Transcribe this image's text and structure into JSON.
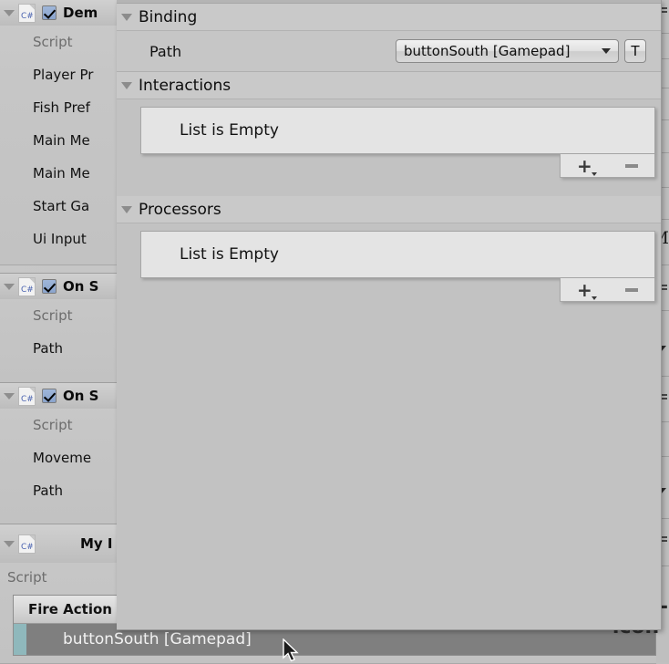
{
  "inspector": {
    "components": [
      {
        "title": "Dem",
        "icon": "csharp-script-icon",
        "enabled": true,
        "properties": [
          {
            "label": "Script",
            "dim": true
          },
          {
            "label": "Player Pr",
            "dim": false
          },
          {
            "label": "Fish Pref",
            "dim": false
          },
          {
            "label": "Main Me",
            "dim": false
          },
          {
            "label": "Main Me",
            "dim": false
          },
          {
            "label": "Start Ga",
            "dim": false
          },
          {
            "label": "Ui Input",
            "dim": false
          }
        ]
      },
      {
        "title": "On S",
        "icon": "csharp-script-icon",
        "enabled": true,
        "properties": [
          {
            "label": "Script",
            "dim": true
          },
          {
            "label": "Path",
            "dim": false
          }
        ]
      },
      {
        "title": "On S",
        "icon": "csharp-script-icon",
        "enabled": true,
        "properties": [
          {
            "label": "Script",
            "dim": true
          },
          {
            "label": "Moveme",
            "dim": false
          },
          {
            "label": "Path",
            "dim": false
          }
        ]
      },
      {
        "title": "My I",
        "icon": "csharp-script-icon",
        "enabled": false,
        "properties": [
          {
            "label": "Script",
            "dim": true
          }
        ]
      }
    ],
    "action_table": {
      "header": "Fire Action",
      "add_glyph": "+",
      "selected_row": "buttonSouth [Gamepad]"
    },
    "gutter": {
      "glyph_m": "M",
      "menu_icon": "hamburger-menu-icon",
      "caret_icon": "chevron-down-icon",
      "plus_icon": "plus-icon"
    }
  },
  "popup": {
    "sections": [
      {
        "id": "binding",
        "title": "Binding",
        "path_label": "Path",
        "path_value": "buttonSouth [Gamepad]",
        "t_button": "T"
      },
      {
        "id": "interactions",
        "title": "Interactions",
        "empty_text": "List is Empty",
        "add_label": "+",
        "remove_label": "−"
      },
      {
        "id": "processors",
        "title": "Processors",
        "empty_text": "List is Empty",
        "add_label": "+",
        "remove_label": "−"
      }
    ]
  },
  "colors": {
    "popup_bg": "#c2c2c2",
    "section_header_bg": "#c9c9c9",
    "empty_box_bg": "#e4e4e4",
    "selected_row_bg": "#7f7f7f",
    "selected_row_accent": "#8fb8bc",
    "script_icon_text": "#4a63b0"
  }
}
